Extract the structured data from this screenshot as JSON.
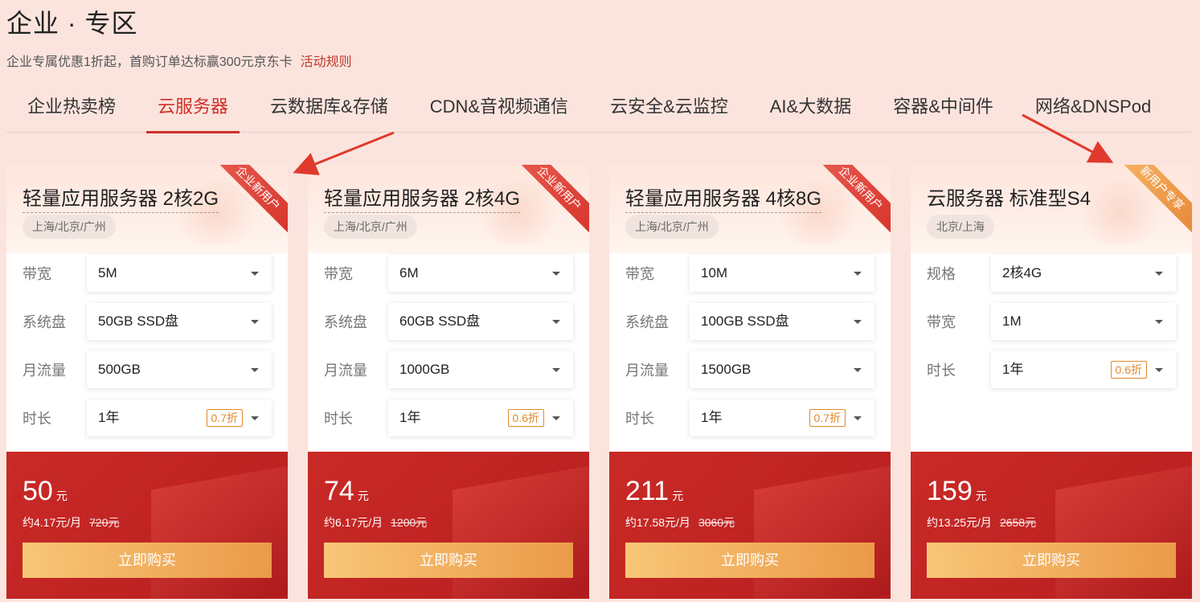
{
  "page": {
    "title": "企业 · 专区",
    "subtitle": "企业专属优惠1折起，首购订单达标赢300元京东卡",
    "rules_link": "活动规则"
  },
  "tabs": [
    {
      "label": "企业热卖榜"
    },
    {
      "label": "云服务器"
    },
    {
      "label": "云数据库&存储"
    },
    {
      "label": "CDN&音视频通信"
    },
    {
      "label": "云安全&云监控"
    },
    {
      "label": "AI&大数据"
    },
    {
      "label": "容器&中间件"
    },
    {
      "label": "网络&DNSPod"
    }
  ],
  "active_tab": 1,
  "cards": [
    {
      "name": "轻量应用服务器 2核2G",
      "badge": "企业新用户",
      "region": "上海/北京/广州",
      "rows": [
        {
          "label": "带宽",
          "value": "5M"
        },
        {
          "label": "系统盘",
          "value": "50GB SSD盘"
        },
        {
          "label": "月流量",
          "value": "500GB"
        },
        {
          "label": "时长",
          "value": "1年",
          "discount": "0.7折"
        }
      ],
      "price": "50",
      "price_unit": "元",
      "monthly": "约4.17元/月",
      "original": "720元",
      "buy": "立即购买"
    },
    {
      "name": "轻量应用服务器 2核4G",
      "badge": "企业新用户",
      "region": "上海/北京/广州",
      "rows": [
        {
          "label": "带宽",
          "value": "6M"
        },
        {
          "label": "系统盘",
          "value": "60GB SSD盘"
        },
        {
          "label": "月流量",
          "value": "1000GB"
        },
        {
          "label": "时长",
          "value": "1年",
          "discount": "0.6折"
        }
      ],
      "price": "74",
      "price_unit": "元",
      "monthly": "约6.17元/月",
      "original": "1200元",
      "buy": "立即购买"
    },
    {
      "name": "轻量应用服务器 4核8G",
      "badge": "企业新用户",
      "region": "上海/北京/广州",
      "rows": [
        {
          "label": "带宽",
          "value": "10M"
        },
        {
          "label": "系统盘",
          "value": "100GB SSD盘"
        },
        {
          "label": "月流量",
          "value": "1500GB"
        },
        {
          "label": "时长",
          "value": "1年",
          "discount": "0.7折"
        }
      ],
      "price": "211",
      "price_unit": "元",
      "monthly": "约17.58元/月",
      "original": "3060元",
      "buy": "立即购买"
    },
    {
      "name": "云服务器 标准型S4",
      "badge": "新用户专享",
      "region": "北京/上海",
      "rows": [
        {
          "label": "规格",
          "value": "2核4G"
        },
        {
          "label": "带宽",
          "value": "1M"
        },
        {
          "label": "时长",
          "value": "1年",
          "discount": "0.6折"
        }
      ],
      "price": "159",
      "price_unit": "元",
      "monthly": "约13.25元/月",
      "original": "2658元",
      "buy": "立即购买"
    }
  ],
  "colors": {
    "background": "#fce4de",
    "accent": "#d0302a",
    "price_panel": "#c92a27",
    "buy_button": "#eb9a48"
  }
}
